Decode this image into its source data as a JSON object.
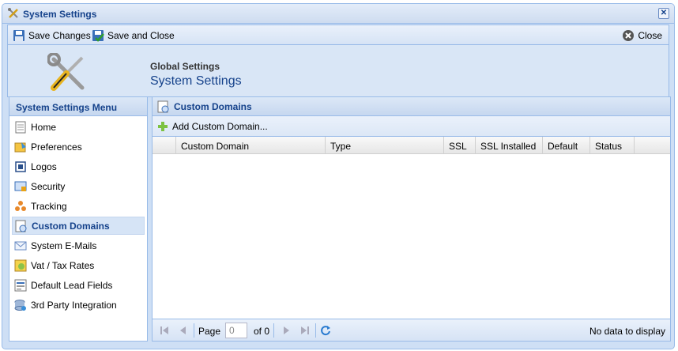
{
  "window": {
    "title": "System Settings",
    "close_symbol": "✕"
  },
  "toolbar": {
    "save_label": "Save Changes",
    "save_close_label": "Save and Close",
    "close_label": "Close"
  },
  "header": {
    "subtitle": "Global Settings",
    "title": "System Settings"
  },
  "sidebar": {
    "title": "System Settings Menu",
    "items": [
      {
        "label": "Home",
        "icon": "home-icon"
      },
      {
        "label": "Preferences",
        "icon": "preferences-icon"
      },
      {
        "label": "Logos",
        "icon": "logos-icon"
      },
      {
        "label": "Security",
        "icon": "security-icon"
      },
      {
        "label": "Tracking",
        "icon": "tracking-icon"
      },
      {
        "label": "Custom Domains",
        "icon": "custom-domains-icon",
        "active": true
      },
      {
        "label": "System E-Mails",
        "icon": "email-icon"
      },
      {
        "label": "Vat / Tax Rates",
        "icon": "tax-icon"
      },
      {
        "label": "Default Lead Fields",
        "icon": "lead-fields-icon"
      },
      {
        "label": "3rd Party Integration",
        "icon": "integration-icon"
      }
    ]
  },
  "main": {
    "title": "Custom Domains",
    "add_label": "Add Custom Domain...",
    "columns": [
      "Custom Domain",
      "Type",
      "SSL",
      "SSL Installed",
      "Default",
      "Status"
    ]
  },
  "pager": {
    "page_label": "Page",
    "page_value": "0",
    "of_label": "of 0",
    "status": "No data to display"
  },
  "colors": {
    "accent": "#15428b",
    "border": "#99bbe8",
    "panel": "#cedff5"
  }
}
